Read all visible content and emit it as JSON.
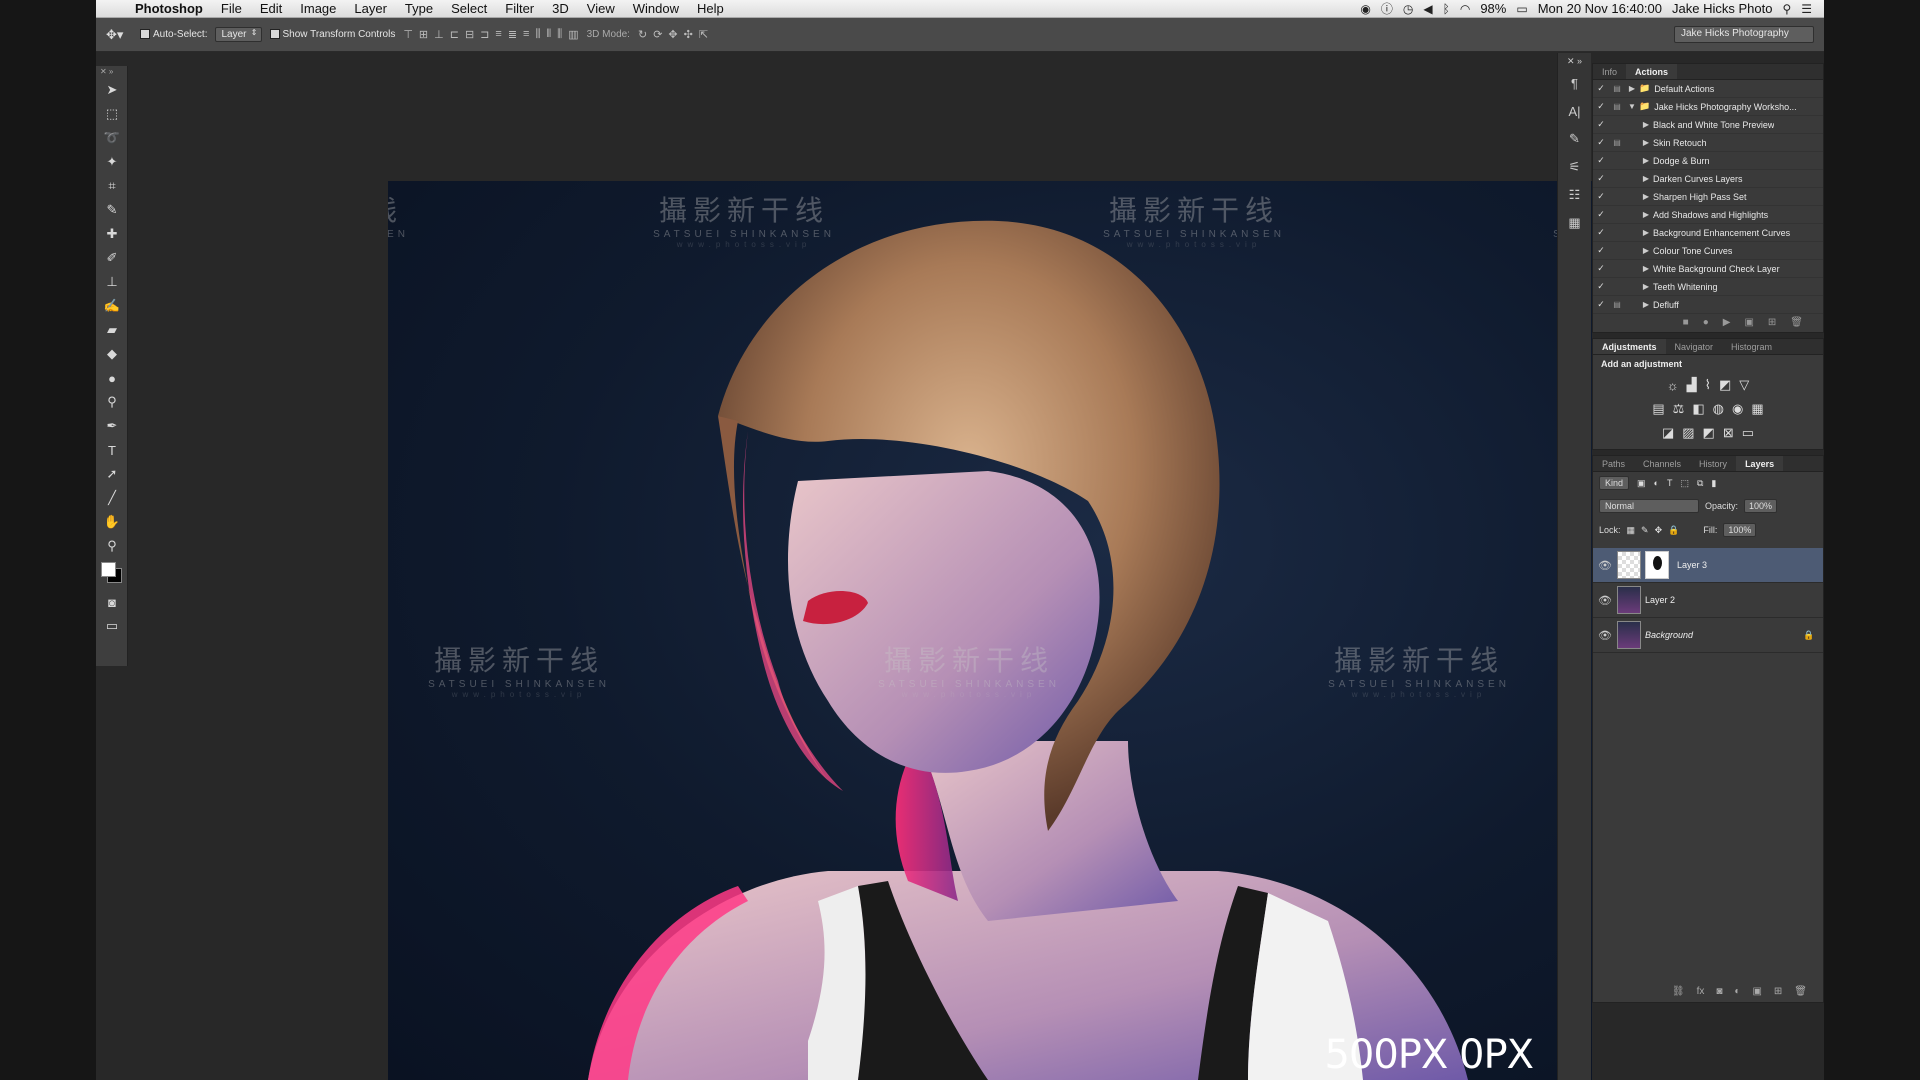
{
  "menubar": {
    "app": "Photoshop",
    "menus": [
      "File",
      "Edit",
      "Image",
      "Layer",
      "Type",
      "Select",
      "Filter",
      "3D",
      "View",
      "Window",
      "Help"
    ],
    "battery": "98%",
    "datetime": "Mon 20 Nov  16:40:00",
    "user": "Jake Hicks Photo"
  },
  "options": {
    "auto_select": "Auto-Select:",
    "auto_select_target": "Layer",
    "show_transform": "Show Transform Controls",
    "mode_3d": "3D Mode:",
    "workspace": "Jake Hicks Photography"
  },
  "watermark": {
    "cn": "攝影新干线",
    "en": "SATSUEI SHINKANSEN",
    "url": "www.photoss.vip"
  },
  "logo": "500PX 0PX",
  "actions_panel": {
    "tabs": [
      "Info",
      "Actions"
    ],
    "active_tab": "Actions",
    "items": [
      {
        "label": "Default Actions",
        "level": 0,
        "expanded": false,
        "folder": true
      },
      {
        "label": "Jake Hicks Photography Worksho...",
        "level": 0,
        "expanded": true,
        "folder": true
      },
      {
        "label": "Black and White Tone Preview",
        "level": 1
      },
      {
        "label": "Skin Retouch",
        "level": 1
      },
      {
        "label": "Dodge & Burn",
        "level": 1
      },
      {
        "label": "Darken Curves Layers",
        "level": 1
      },
      {
        "label": "Sharpen High Pass Set",
        "level": 1
      },
      {
        "label": "Add Shadows and Highlights",
        "level": 1
      },
      {
        "label": "Background Enhancement Curves",
        "level": 1
      },
      {
        "label": "Colour Tone Curves",
        "level": 1
      },
      {
        "label": "White Background Check Layer",
        "level": 1
      },
      {
        "label": "Teeth Whitening",
        "level": 1
      },
      {
        "label": "Defluff",
        "level": 1
      }
    ]
  },
  "adjustments_panel": {
    "tabs": [
      "Adjustments",
      "Navigator",
      "Histogram"
    ],
    "active_tab": "Adjustments",
    "title": "Add an adjustment"
  },
  "layers_panel": {
    "tabs": [
      "Paths",
      "Channels",
      "History",
      "Layers"
    ],
    "active_tab": "Layers",
    "kind": "Kind",
    "blend_mode": "Normal",
    "opacity_label": "Opacity:",
    "opacity": "100%",
    "lock_label": "Lock:",
    "fill_label": "Fill:",
    "fill": "100%",
    "layers": [
      {
        "name": "Layer 3",
        "selected": true,
        "has_mask": true
      },
      {
        "name": "Layer 2",
        "selected": false,
        "has_mask": false
      },
      {
        "name": "Background",
        "selected": false,
        "has_mask": false,
        "locked": true
      }
    ]
  }
}
